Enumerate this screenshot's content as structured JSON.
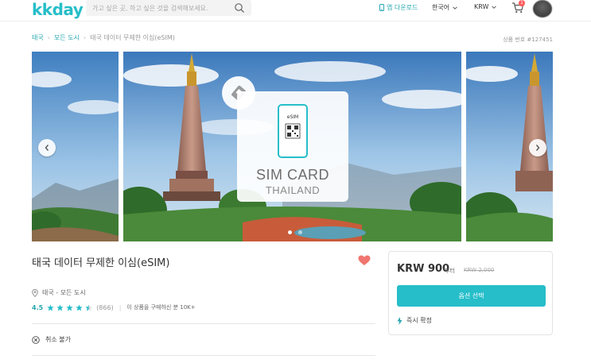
{
  "header": {
    "logo": "kkday",
    "search_placeholder": "가고 싶은 곳, 하고 싶은 것을 검색해보세요.",
    "app_download": "앱 다운로드",
    "language": "한국어",
    "currency": "KRW",
    "cart_count": "1"
  },
  "breadcrumb": {
    "items": [
      "태국",
      "모든 도시",
      "태국 데이터 무제한 이심(eSIM)"
    ],
    "product_number": "상품 번호 #127451"
  },
  "carousel": {
    "card_title": "SIM CARD",
    "card_subtitle": "THAILAND",
    "phone_label": "eSIM",
    "slide_count": 2,
    "active_slide": 0
  },
  "product": {
    "title": "태국 데이터 무제한 이심(eSIM)",
    "location": "태국 - 모든 도시",
    "rating": "4.5",
    "stars": 4.5,
    "review_count": "(866)",
    "booked": "이 상품을 구매하신 분 10K+",
    "cancel_policy": "취소 불가"
  },
  "price_box": {
    "price": "KRW 900",
    "from_label": "부터",
    "original_price": "KRW 2,000",
    "select_button": "옵션 선택",
    "instant_confirm": "즉시 확정"
  },
  "colors": {
    "brand": "#26bec9",
    "heart": "#f0766f",
    "star": "#26bec9"
  }
}
